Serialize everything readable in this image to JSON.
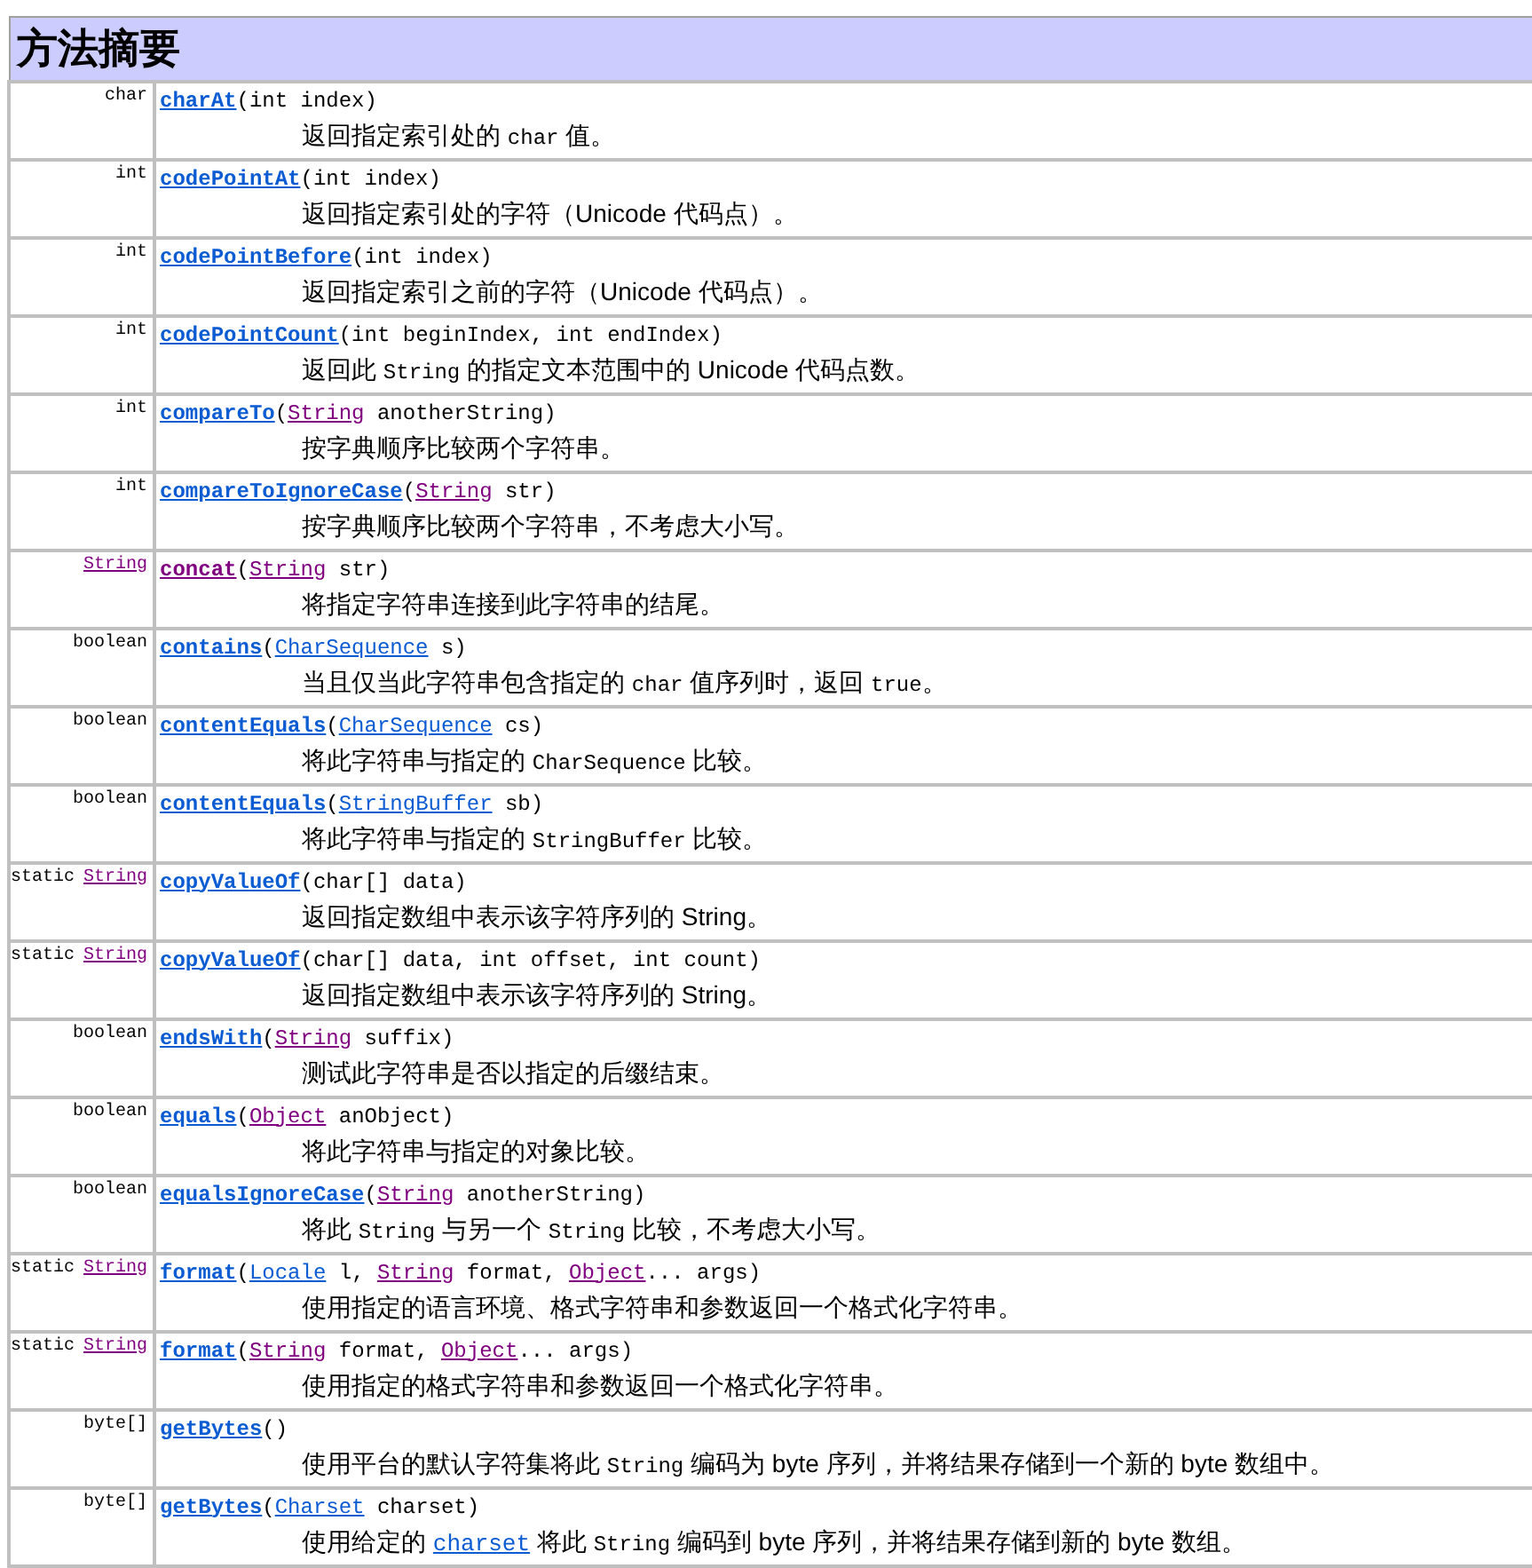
{
  "title": "方法摘要",
  "methods": [
    {
      "type": [
        {
          "kind": "text",
          "text": "char"
        }
      ],
      "name": {
        "text": "charAt",
        "visited": false
      },
      "params": [
        {
          "kind": "text",
          "text": "(int index)"
        }
      ],
      "description": [
        {
          "kind": "text",
          "text": "返回指定索引处的 "
        },
        {
          "kind": "code",
          "text": "char"
        },
        {
          "kind": "text",
          "text": " 值。"
        }
      ]
    },
    {
      "type": [
        {
          "kind": "text",
          "text": "int"
        }
      ],
      "name": {
        "text": "codePointAt",
        "visited": false
      },
      "params": [
        {
          "kind": "text",
          "text": "(int index)"
        }
      ],
      "description": [
        {
          "kind": "text",
          "text": "返回指定索引处的字符（Unicode 代码点）。"
        }
      ]
    },
    {
      "type": [
        {
          "kind": "text",
          "text": "int"
        }
      ],
      "name": {
        "text": "codePointBefore",
        "visited": false
      },
      "params": [
        {
          "kind": "text",
          "text": "(int index)"
        }
      ],
      "description": [
        {
          "kind": "text",
          "text": "返回指定索引之前的字符（Unicode 代码点）。"
        }
      ]
    },
    {
      "type": [
        {
          "kind": "text",
          "text": "int"
        }
      ],
      "name": {
        "text": "codePointCount",
        "visited": false
      },
      "params": [
        {
          "kind": "text",
          "text": "(int beginIndex, int endIndex)"
        }
      ],
      "description": [
        {
          "kind": "text",
          "text": "返回此 "
        },
        {
          "kind": "code",
          "text": "String"
        },
        {
          "kind": "text",
          "text": " 的指定文本范围中的 Unicode 代码点数。"
        }
      ]
    },
    {
      "type": [
        {
          "kind": "text",
          "text": "int"
        }
      ],
      "name": {
        "text": "compareTo",
        "visited": false
      },
      "params": [
        {
          "kind": "text",
          "text": "("
        },
        {
          "kind": "visited",
          "text": "String"
        },
        {
          "kind": "text",
          "text": " anotherString)"
        }
      ],
      "description": [
        {
          "kind": "text",
          "text": "按字典顺序比较两个字符串。"
        }
      ]
    },
    {
      "type": [
        {
          "kind": "text",
          "text": "int"
        }
      ],
      "name": {
        "text": "compareToIgnoreCase",
        "visited": false
      },
      "params": [
        {
          "kind": "text",
          "text": "("
        },
        {
          "kind": "visited",
          "text": "String"
        },
        {
          "kind": "text",
          "text": " str)"
        }
      ],
      "description": [
        {
          "kind": "text",
          "text": "按字典顺序比较两个字符串，不考虑大小写。"
        }
      ]
    },
    {
      "type": [
        {
          "kind": "visited",
          "text": "String"
        }
      ],
      "name": {
        "text": "concat",
        "visited": true
      },
      "params": [
        {
          "kind": "text",
          "text": "("
        },
        {
          "kind": "visited",
          "text": "String"
        },
        {
          "kind": "text",
          "text": " str)"
        }
      ],
      "description": [
        {
          "kind": "text",
          "text": "将指定字符串连接到此字符串的结尾。"
        }
      ]
    },
    {
      "type": [
        {
          "kind": "text",
          "text": "boolean"
        }
      ],
      "name": {
        "text": "contains",
        "visited": false
      },
      "params": [
        {
          "kind": "text",
          "text": "("
        },
        {
          "kind": "link",
          "text": "CharSequence"
        },
        {
          "kind": "text",
          "text": " s)"
        }
      ],
      "description": [
        {
          "kind": "text",
          "text": "当且仅当此字符串包含指定的 "
        },
        {
          "kind": "code",
          "text": "char"
        },
        {
          "kind": "text",
          "text": " 值序列时，返回 "
        },
        {
          "kind": "code",
          "text": "true"
        },
        {
          "kind": "text",
          "text": "。"
        }
      ]
    },
    {
      "type": [
        {
          "kind": "text",
          "text": "boolean"
        }
      ],
      "name": {
        "text": "contentEquals",
        "visited": false
      },
      "params": [
        {
          "kind": "text",
          "text": "("
        },
        {
          "kind": "link",
          "text": "CharSequence"
        },
        {
          "kind": "text",
          "text": " cs)"
        }
      ],
      "description": [
        {
          "kind": "text",
          "text": "将此字符串与指定的 "
        },
        {
          "kind": "code",
          "text": "CharSequence"
        },
        {
          "kind": "text",
          "text": " 比较。"
        }
      ]
    },
    {
      "type": [
        {
          "kind": "text",
          "text": "boolean"
        }
      ],
      "name": {
        "text": "contentEquals",
        "visited": false
      },
      "params": [
        {
          "kind": "text",
          "text": "("
        },
        {
          "kind": "link",
          "text": "StringBuffer"
        },
        {
          "kind": "text",
          "text": " sb)"
        }
      ],
      "description": [
        {
          "kind": "text",
          "text": "将此字符串与指定的 "
        },
        {
          "kind": "code",
          "text": "StringBuffer"
        },
        {
          "kind": "text",
          "text": " 比较。"
        }
      ]
    },
    {
      "type": [
        {
          "kind": "text",
          "text": "static"
        },
        {
          "kind": "visited",
          "text": "String"
        }
      ],
      "name": {
        "text": "copyValueOf",
        "visited": false
      },
      "params": [
        {
          "kind": "text",
          "text": "(char[] data)"
        }
      ],
      "description": [
        {
          "kind": "text",
          "text": "返回指定数组中表示该字符序列的 String。"
        }
      ]
    },
    {
      "type": [
        {
          "kind": "text",
          "text": "static"
        },
        {
          "kind": "visited",
          "text": "String"
        }
      ],
      "name": {
        "text": "copyValueOf",
        "visited": false
      },
      "params": [
        {
          "kind": "text",
          "text": "(char[] data, int offset, int count)"
        }
      ],
      "description": [
        {
          "kind": "text",
          "text": "返回指定数组中表示该字符序列的 String。"
        }
      ]
    },
    {
      "type": [
        {
          "kind": "text",
          "text": "boolean"
        }
      ],
      "name": {
        "text": "endsWith",
        "visited": false
      },
      "params": [
        {
          "kind": "text",
          "text": "("
        },
        {
          "kind": "visited",
          "text": "String"
        },
        {
          "kind": "text",
          "text": " suffix)"
        }
      ],
      "description": [
        {
          "kind": "text",
          "text": "测试此字符串是否以指定的后缀结束。"
        }
      ]
    },
    {
      "type": [
        {
          "kind": "text",
          "text": "boolean"
        }
      ],
      "name": {
        "text": "equals",
        "visited": false
      },
      "params": [
        {
          "kind": "text",
          "text": "("
        },
        {
          "kind": "visited",
          "text": "Object"
        },
        {
          "kind": "text",
          "text": " anObject)"
        }
      ],
      "description": [
        {
          "kind": "text",
          "text": "将此字符串与指定的对象比较。"
        }
      ]
    },
    {
      "type": [
        {
          "kind": "text",
          "text": "boolean"
        }
      ],
      "name": {
        "text": "equalsIgnoreCase",
        "visited": false
      },
      "params": [
        {
          "kind": "text",
          "text": "("
        },
        {
          "kind": "visited",
          "text": "String"
        },
        {
          "kind": "text",
          "text": " anotherString)"
        }
      ],
      "description": [
        {
          "kind": "text",
          "text": "将此 "
        },
        {
          "kind": "code",
          "text": "String"
        },
        {
          "kind": "text",
          "text": " 与另一个 "
        },
        {
          "kind": "code",
          "text": "String"
        },
        {
          "kind": "text",
          "text": " 比较，不考虑大小写。"
        }
      ]
    },
    {
      "type": [
        {
          "kind": "text",
          "text": "static"
        },
        {
          "kind": "visited",
          "text": "String"
        }
      ],
      "name": {
        "text": "format",
        "visited": false
      },
      "params": [
        {
          "kind": "text",
          "text": "("
        },
        {
          "kind": "link",
          "text": "Locale"
        },
        {
          "kind": "text",
          "text": " l, "
        },
        {
          "kind": "visited",
          "text": "String"
        },
        {
          "kind": "text",
          "text": " format, "
        },
        {
          "kind": "visited",
          "text": "Object"
        },
        {
          "kind": "text",
          "text": "... args)"
        }
      ],
      "description": [
        {
          "kind": "text",
          "text": "使用指定的语言环境、格式字符串和参数返回一个格式化字符串。"
        }
      ]
    },
    {
      "type": [
        {
          "kind": "text",
          "text": "static"
        },
        {
          "kind": "visited",
          "text": "String"
        }
      ],
      "name": {
        "text": "format",
        "visited": false
      },
      "params": [
        {
          "kind": "text",
          "text": "("
        },
        {
          "kind": "visited",
          "text": "String"
        },
        {
          "kind": "text",
          "text": " format, "
        },
        {
          "kind": "visited",
          "text": "Object"
        },
        {
          "kind": "text",
          "text": "... args)"
        }
      ],
      "description": [
        {
          "kind": "text",
          "text": "使用指定的格式字符串和参数返回一个格式化字符串。"
        }
      ]
    },
    {
      "type": [
        {
          "kind": "text",
          "text": "byte[]"
        }
      ],
      "name": {
        "text": "getBytes",
        "visited": false
      },
      "params": [
        {
          "kind": "text",
          "text": "()"
        }
      ],
      "description": [
        {
          "kind": "text",
          "text": "使用平台的默认字符集将此 "
        },
        {
          "kind": "code",
          "text": "String"
        },
        {
          "kind": "text",
          "text": " 编码为 byte 序列，并将结果存储到一个新的 byte 数组中。"
        }
      ]
    },
    {
      "type": [
        {
          "kind": "text",
          "text": "byte[]"
        }
      ],
      "name": {
        "text": "getBytes",
        "visited": false
      },
      "params": [
        {
          "kind": "text",
          "text": "("
        },
        {
          "kind": "link",
          "text": "Charset"
        },
        {
          "kind": "text",
          "text": " charset)"
        }
      ],
      "description": [
        {
          "kind": "text",
          "text": "使用给定的 "
        },
        {
          "kind": "link",
          "text": "charset"
        },
        {
          "kind": "text",
          "text": " 将此 "
        },
        {
          "kind": "code",
          "text": "String"
        },
        {
          "kind": "text",
          "text": " 编码到 byte 序列，并将结果存储到新的 byte 数组。"
        }
      ]
    }
  ]
}
